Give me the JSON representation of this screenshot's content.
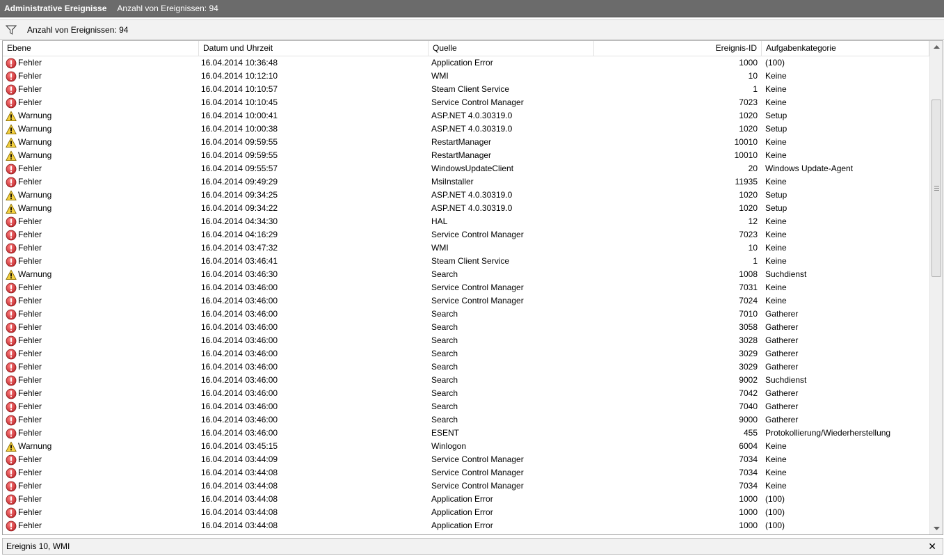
{
  "titlebar": {
    "title": "Administrative Ereignisse",
    "count": "Anzahl von Ereignissen: 94"
  },
  "filterbar": {
    "icon": "filter-icon",
    "text": "Anzahl von Ereignissen: 94"
  },
  "columns": {
    "level": "Ebene",
    "date": "Datum und Uhrzeit",
    "source": "Quelle",
    "id": "Ereignis-ID",
    "category": "Aufgabenkategorie"
  },
  "colors": {
    "error": "#c0282d",
    "warning": "#f4d03f"
  },
  "events": [
    {
      "level": "Fehler",
      "type": "error",
      "date": "16.04.2014 10:36:48",
      "source": "Application Error",
      "id": "1000",
      "category": "(100)"
    },
    {
      "level": "Fehler",
      "type": "error",
      "date": "16.04.2014 10:12:10",
      "source": "WMI",
      "id": "10",
      "category": "Keine"
    },
    {
      "level": "Fehler",
      "type": "error",
      "date": "16.04.2014 10:10:57",
      "source": "Steam Client Service",
      "id": "1",
      "category": "Keine"
    },
    {
      "level": "Fehler",
      "type": "error",
      "date": "16.04.2014 10:10:45",
      "source": "Service Control Manager",
      "id": "7023",
      "category": "Keine"
    },
    {
      "level": "Warnung",
      "type": "warning",
      "date": "16.04.2014 10:00:41",
      "source": "ASP.NET 4.0.30319.0",
      "id": "1020",
      "category": "Setup"
    },
    {
      "level": "Warnung",
      "type": "warning",
      "date": "16.04.2014 10:00:38",
      "source": "ASP.NET 4.0.30319.0",
      "id": "1020",
      "category": "Setup"
    },
    {
      "level": "Warnung",
      "type": "warning",
      "date": "16.04.2014 09:59:55",
      "source": "RestartManager",
      "id": "10010",
      "category": "Keine"
    },
    {
      "level": "Warnung",
      "type": "warning",
      "date": "16.04.2014 09:59:55",
      "source": "RestartManager",
      "id": "10010",
      "category": "Keine"
    },
    {
      "level": "Fehler",
      "type": "error",
      "date": "16.04.2014 09:55:57",
      "source": "WindowsUpdateClient",
      "id": "20",
      "category": "Windows Update-Agent"
    },
    {
      "level": "Fehler",
      "type": "error",
      "date": "16.04.2014 09:49:29",
      "source": "MsiInstaller",
      "id": "11935",
      "category": "Keine"
    },
    {
      "level": "Warnung",
      "type": "warning",
      "date": "16.04.2014 09:34:25",
      "source": "ASP.NET 4.0.30319.0",
      "id": "1020",
      "category": "Setup"
    },
    {
      "level": "Warnung",
      "type": "warning",
      "date": "16.04.2014 09:34:22",
      "source": "ASP.NET 4.0.30319.0",
      "id": "1020",
      "category": "Setup"
    },
    {
      "level": "Fehler",
      "type": "error",
      "date": "16.04.2014 04:34:30",
      "source": "HAL",
      "id": "12",
      "category": "Keine"
    },
    {
      "level": "Fehler",
      "type": "error",
      "date": "16.04.2014 04:16:29",
      "source": "Service Control Manager",
      "id": "7023",
      "category": "Keine"
    },
    {
      "level": "Fehler",
      "type": "error",
      "date": "16.04.2014 03:47:32",
      "source": "WMI",
      "id": "10",
      "category": "Keine"
    },
    {
      "level": "Fehler",
      "type": "error",
      "date": "16.04.2014 03:46:41",
      "source": "Steam Client Service",
      "id": "1",
      "category": "Keine"
    },
    {
      "level": "Warnung",
      "type": "warning",
      "date": "16.04.2014 03:46:30",
      "source": "Search",
      "id": "1008",
      "category": "Suchdienst"
    },
    {
      "level": "Fehler",
      "type": "error",
      "date": "16.04.2014 03:46:00",
      "source": "Service Control Manager",
      "id": "7031",
      "category": "Keine"
    },
    {
      "level": "Fehler",
      "type": "error",
      "date": "16.04.2014 03:46:00",
      "source": "Service Control Manager",
      "id": "7024",
      "category": "Keine"
    },
    {
      "level": "Fehler",
      "type": "error",
      "date": "16.04.2014 03:46:00",
      "source": "Search",
      "id": "7010",
      "category": "Gatherer"
    },
    {
      "level": "Fehler",
      "type": "error",
      "date": "16.04.2014 03:46:00",
      "source": "Search",
      "id": "3058",
      "category": "Gatherer"
    },
    {
      "level": "Fehler",
      "type": "error",
      "date": "16.04.2014 03:46:00",
      "source": "Search",
      "id": "3028",
      "category": "Gatherer"
    },
    {
      "level": "Fehler",
      "type": "error",
      "date": "16.04.2014 03:46:00",
      "source": "Search",
      "id": "3029",
      "category": "Gatherer"
    },
    {
      "level": "Fehler",
      "type": "error",
      "date": "16.04.2014 03:46:00",
      "source": "Search",
      "id": "3029",
      "category": "Gatherer"
    },
    {
      "level": "Fehler",
      "type": "error",
      "date": "16.04.2014 03:46:00",
      "source": "Search",
      "id": "9002",
      "category": "Suchdienst"
    },
    {
      "level": "Fehler",
      "type": "error",
      "date": "16.04.2014 03:46:00",
      "source": "Search",
      "id": "7042",
      "category": "Gatherer"
    },
    {
      "level": "Fehler",
      "type": "error",
      "date": "16.04.2014 03:46:00",
      "source": "Search",
      "id": "7040",
      "category": "Gatherer"
    },
    {
      "level": "Fehler",
      "type": "error",
      "date": "16.04.2014 03:46:00",
      "source": "Search",
      "id": "9000",
      "category": "Gatherer"
    },
    {
      "level": "Fehler",
      "type": "error",
      "date": "16.04.2014 03:46:00",
      "source": "ESENT",
      "id": "455",
      "category": "Protokollierung/Wiederherstellung"
    },
    {
      "level": "Warnung",
      "type": "warning",
      "date": "16.04.2014 03:45:15",
      "source": "Winlogon",
      "id": "6004",
      "category": "Keine"
    },
    {
      "level": "Fehler",
      "type": "error",
      "date": "16.04.2014 03:44:09",
      "source": "Service Control Manager",
      "id": "7034",
      "category": "Keine"
    },
    {
      "level": "Fehler",
      "type": "error",
      "date": "16.04.2014 03:44:08",
      "source": "Service Control Manager",
      "id": "7034",
      "category": "Keine"
    },
    {
      "level": "Fehler",
      "type": "error",
      "date": "16.04.2014 03:44:08",
      "source": "Service Control Manager",
      "id": "7034",
      "category": "Keine"
    },
    {
      "level": "Fehler",
      "type": "error",
      "date": "16.04.2014 03:44:08",
      "source": "Application Error",
      "id": "1000",
      "category": "(100)"
    },
    {
      "level": "Fehler",
      "type": "error",
      "date": "16.04.2014 03:44:08",
      "source": "Application Error",
      "id": "1000",
      "category": "(100)"
    },
    {
      "level": "Fehler",
      "type": "error",
      "date": "16.04.2014 03:44:08",
      "source": "Application Error",
      "id": "1000",
      "category": "(100)"
    }
  ],
  "detail_panel": {
    "title": "Ereignis 10, WMI",
    "close": "✕"
  }
}
